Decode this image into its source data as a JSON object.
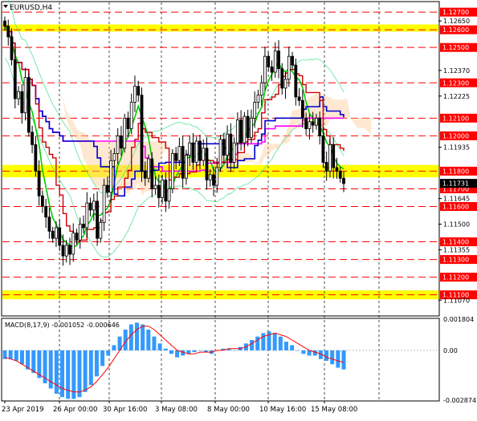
{
  "header": {
    "symbol": "EURUSD,H4"
  },
  "macd": {
    "label": "MACD(8,17,9)",
    "value1": "-0.001052",
    "value2": "-0.000646"
  },
  "chart_data": [
    {
      "type": "candlestick",
      "title": "EURUSD,H4",
      "ylim": [
        1.10985,
        1.12755
      ],
      "highlighted_levels": [
        {
          "price": 1.127,
          "label": "1.12700"
        },
        {
          "price": 1.126,
          "label": "1.12600"
        },
        {
          "price": 1.125,
          "label": "1.12500"
        },
        {
          "price": 1.123,
          "label": "1.12300"
        },
        {
          "price": 1.121,
          "label": "1.12100"
        },
        {
          "price": 1.12,
          "label": "1.12000"
        },
        {
          "price": 1.118,
          "label": "1.11800"
        },
        {
          "price": 1.117,
          "label": "1.11700"
        },
        {
          "price": 1.116,
          "label": "1.11600"
        },
        {
          "price": 1.114,
          "label": "1.11400"
        },
        {
          "price": 1.113,
          "label": "1.11300"
        },
        {
          "price": 1.112,
          "label": "1.11200"
        },
        {
          "price": 1.111,
          "label": "1.11100"
        }
      ],
      "plain_ticks": [
        "1.12650",
        "1.12370",
        "1.12225",
        "1.11935",
        "1.11645",
        "1.11500",
        "1.11355",
        "1.11070"
      ],
      "current_price": {
        "price": 1.11731,
        "label": "1.11731"
      },
      "x_labels": [
        "23 Apr 2019",
        "26 Apr 00:00",
        "30 Apr 16:00",
        "3 May 08:00",
        "8 May 00:00",
        "10 May 16:00",
        "15 May 08:00"
      ],
      "zones": [
        {
          "from": 1.1259,
          "to": 1.1263,
          "color": "#ffff00"
        },
        {
          "from": 1.11765,
          "to": 1.11835,
          "color": "#ffff00"
        },
        {
          "from": 1.11075,
          "to": 1.11125,
          "color": "#ffff00"
        }
      ],
      "close_series": [
        1.1262,
        1.1256,
        1.1243,
        1.1221,
        1.1225,
        1.1213,
        1.1233,
        1.1202,
        1.1195,
        1.118,
        1.1166,
        1.116,
        1.1154,
        1.1146,
        1.1142,
        1.1148,
        1.1138,
        1.1132,
        1.1138,
        1.1133,
        1.1145,
        1.1141,
        1.115,
        1.1148,
        1.1162,
        1.1158,
        1.1163,
        1.1142,
        1.1151,
        1.1172,
        1.1168,
        1.1186,
        1.119,
        1.12,
        1.1193,
        1.121,
        1.1204,
        1.1219,
        1.1228,
        1.1223,
        1.118,
        1.1176,
        1.1187,
        1.117,
        1.1172,
        1.1165,
        1.1175,
        1.1163,
        1.117,
        1.119,
        1.1186,
        1.1194,
        1.1176,
        1.1189,
        1.1196,
        1.1185,
        1.1197,
        1.1186,
        1.1193,
        1.1175,
        1.1178,
        1.1172,
        1.1182,
        1.1198,
        1.1189,
        1.1201,
        1.1185,
        1.1196,
        1.1209,
        1.1196,
        1.1211,
        1.1199,
        1.121,
        1.1219,
        1.1223,
        1.123,
        1.1245,
        1.1239,
        1.1236,
        1.1248,
        1.1238,
        1.1227,
        1.1232,
        1.1245,
        1.124,
        1.1222,
        1.122,
        1.121,
        1.1204,
        1.1208,
        1.1206,
        1.121,
        1.12,
        1.1185,
        1.118,
        1.1195,
        1.1182,
        1.118,
        1.1176,
        1.1173
      ]
    },
    {
      "type": "bar",
      "title": "MACD(8,17,9)",
      "ylim": [
        -0.002874,
        0.001804
      ],
      "ticks": [
        "0.001804",
        "0.00",
        "-0.002874"
      ],
      "histogram": [
        -0.0005,
        -0.0005,
        -0.0006,
        -0.0008,
        -0.0011,
        -0.0013,
        -0.0016,
        -0.0019,
        -0.0022,
        -0.0025,
        -0.0027,
        -0.0028,
        -0.0028,
        -0.0027,
        -0.0024,
        -0.002,
        -0.0015,
        -0.0009,
        -0.0003,
        0.0003,
        0.0008,
        0.0012,
        0.0015,
        0.0016,
        0.0015,
        0.0012,
        0.0008,
        0.0004,
        0.0001,
        -0.0002,
        -0.0004,
        -0.0003,
        -0.0002,
        -0.0001,
        0.0,
        -0.0001,
        -0.0002,
        0.0,
        0.0001,
        0.0001,
        0.0,
        0.0002,
        0.0004,
        0.0006,
        0.0008,
        0.001,
        0.0011,
        0.001,
        0.0008,
        0.0005,
        0.0003,
        0.0,
        -0.0002,
        -0.0003,
        -0.0003,
        -0.0005,
        -0.0006,
        -0.0008,
        -0.001,
        -0.0011
      ],
      "signal": [
        -0.0004,
        -0.0005,
        -0.0006,
        -0.0008,
        -0.001,
        -0.0012,
        -0.0014,
        -0.0016,
        -0.0018,
        -0.002,
        -0.0022,
        -0.0023,
        -0.0024,
        -0.0024,
        -0.0023,
        -0.0021,
        -0.0018,
        -0.0014,
        -0.001,
        -0.0005,
        0.0,
        0.0005,
        0.0009,
        0.0012,
        0.0014,
        0.0014,
        0.0012,
        0.0009,
        0.0006,
        0.0003,
        0.0,
        -0.0001,
        -0.0002,
        -0.0002,
        -0.0001,
        -0.0001,
        -0.0001,
        0.0,
        0.0,
        0.0001,
        0.0001,
        0.0001,
        0.0002,
        0.0004,
        0.0006,
        0.0008,
        0.0009,
        0.001,
        0.0009,
        0.0008,
        0.0006,
        0.0004,
        0.0002,
        0.0,
        -0.0001,
        -0.0002,
        -0.0004,
        -0.0005,
        -0.0006,
        -0.0007
      ]
    }
  ],
  "colors": {
    "zone": "#ffff00",
    "level": "#ff0000",
    "level_label_bg": "#ff0000",
    "tenkan": "#cc0000",
    "kijun": "#0000cc",
    "senkou_a": "#ff00ff",
    "ma_green": "#00cc00",
    "envelope": "#44dd88",
    "macd_bars": "#3399ff",
    "macd_signal": "#ff0000",
    "cloud": "#ffcc99"
  }
}
